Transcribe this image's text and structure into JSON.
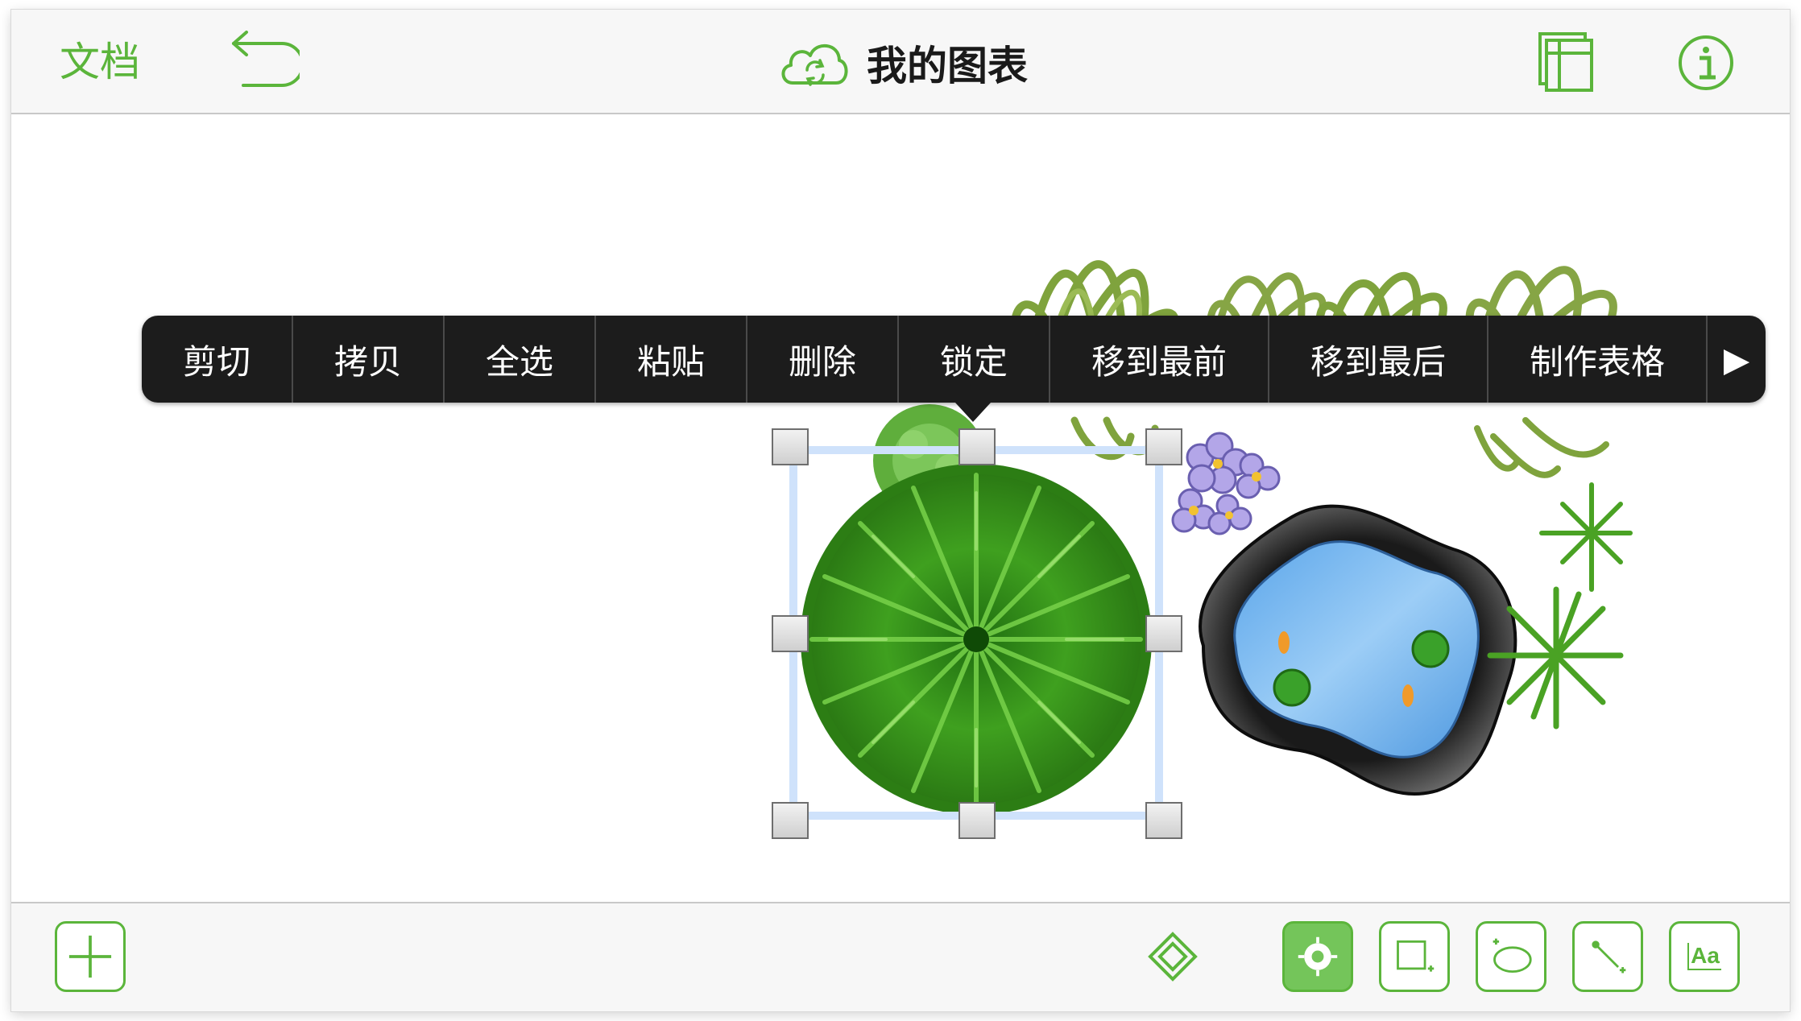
{
  "header": {
    "docs_label": "文档",
    "title": "我的图表"
  },
  "context_menu": {
    "items": [
      "剪切",
      "拷贝",
      "全选",
      "粘贴",
      "删除",
      "锁定",
      "移到最前",
      "移到最后",
      "制作表格"
    ],
    "more": "▶"
  },
  "toolbar": {
    "tools": [
      "add",
      "inspector",
      "selection",
      "shape",
      "freehand",
      "line",
      "text"
    ],
    "active_tool": "selection",
    "text_tool_label": "Aa"
  },
  "colors": {
    "accent": "#5bb53b",
    "menu_bg": "#1c1c1c",
    "selection": "#cfe2fb",
    "pond_water": "#6fb3f0"
  },
  "icons": [
    "undo-icon",
    "cloud-sync-icon",
    "layers-icon",
    "info-icon",
    "plus-icon",
    "diamond-icon",
    "target-icon",
    "rectangle-tool-icon",
    "lasso-icon",
    "line-tool-icon"
  ]
}
